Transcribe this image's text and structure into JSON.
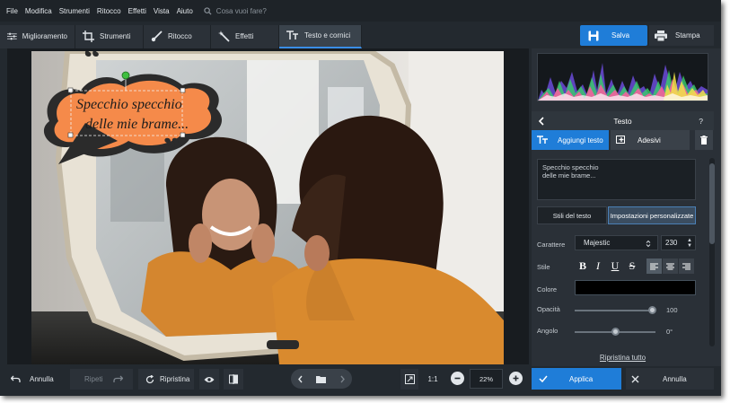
{
  "menu": {
    "items": [
      "File",
      "Modifica",
      "Strumenti",
      "Ritocco",
      "Effetti",
      "Vista",
      "Aiuto"
    ],
    "search_placeholder": "Cosa vuoi fare?"
  },
  "tabs": [
    {
      "label": "Miglioramento",
      "icon": "sliders-icon"
    },
    {
      "label": "Strumenti",
      "icon": "crop-icon"
    },
    {
      "label": "Ritocco",
      "icon": "brush-icon"
    },
    {
      "label": "Effetti",
      "icon": "magic-wand-icon"
    },
    {
      "label": "Testo e cornici",
      "icon": "text-icon",
      "active": true
    }
  ],
  "toolbar": {
    "save_label": "Salva",
    "print_label": "Stampa"
  },
  "canvas": {
    "speech_bubble_text_line1": "Specchio specchio",
    "speech_bubble_text_line2": "delle mie brame..."
  },
  "panel": {
    "title": "Testo",
    "add_text_label": "Aggiungi testo",
    "stickers_label": "Adesivi",
    "text_value": "Specchio specchio\ndelle mie brame...",
    "tab_styles": "Stili del testo",
    "tab_custom": "Impostazioni personalizzate",
    "font_label": "Carattere",
    "font_value": "Majestic",
    "size_value": "230",
    "style_label": "Stile",
    "bold": "B",
    "italic": "I",
    "underline": "U",
    "strike": "S",
    "color_label": "Colore",
    "color_value": "#000000",
    "opacity_label": "Opacità",
    "opacity_value": "100",
    "angle_label": "Angolo",
    "angle_value": "0°",
    "reset_all": "Ripristina tutto"
  },
  "bottom": {
    "undo_label": "Annulla",
    "redo_label": "Ripeti",
    "reset_label": "Ripristina",
    "zoom_label_ratio": "1:1",
    "zoom_value": "22%",
    "apply_label": "Applica",
    "cancel_label": "Annulla"
  },
  "colors": {
    "accent": "#1f7dd8",
    "bubble_fill": "#f58a4a",
    "bubble_outline": "#3b3b3b",
    "background": "#23292f"
  }
}
